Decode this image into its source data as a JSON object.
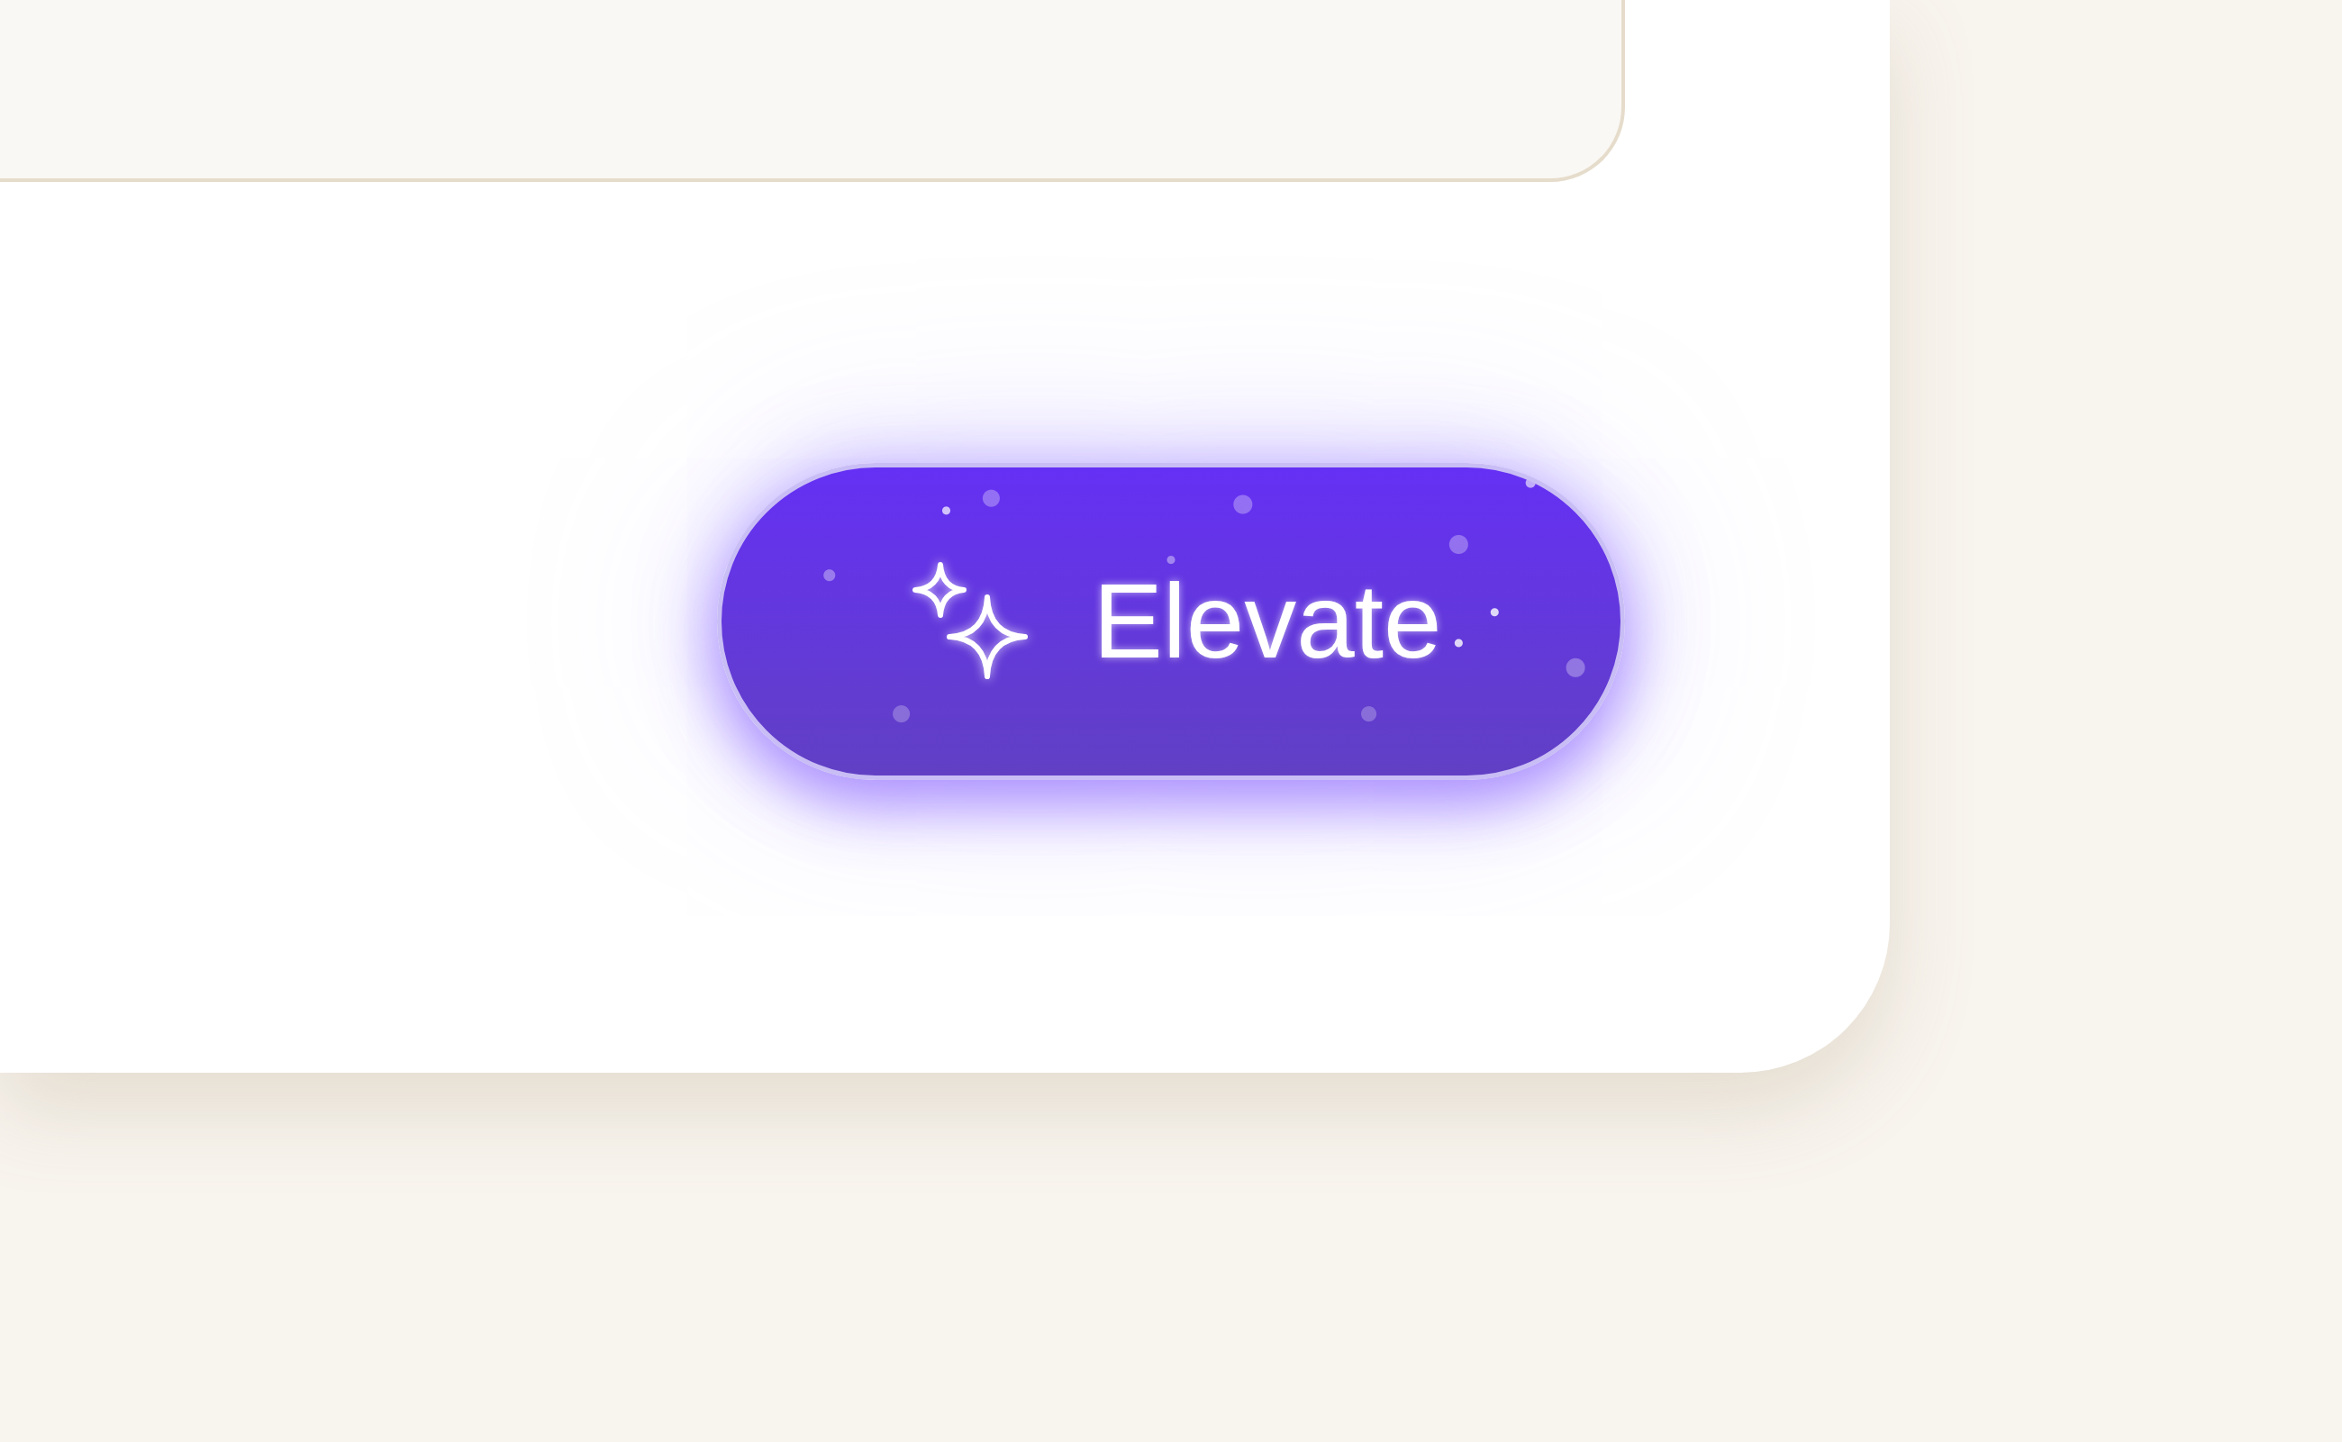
{
  "button": {
    "label": "Elevate"
  }
}
